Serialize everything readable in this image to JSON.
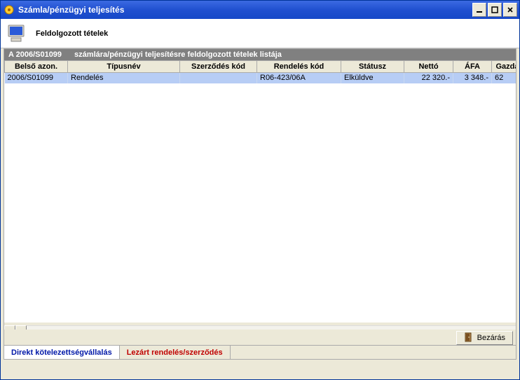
{
  "window": {
    "title": "Számla/pénzügyi teljesítés"
  },
  "header": {
    "title": "Feldolgozott tételek"
  },
  "listing": {
    "prefix": "A 2006/S01099",
    "suffix": "számlára/pénzügyi teljesítésre feldolgozott tételek listája"
  },
  "columns": {
    "belso_azon": "Belső azon.",
    "tipusnev": "Típusnév",
    "szerzodes_kod": "Szerződés kód",
    "rendeles_kod": "Rendelés kód",
    "statusz": "Státusz",
    "netto": "Nettó",
    "afa": "ÁFA",
    "gazda": "Gazdá"
  },
  "rows": [
    {
      "belso_azon": "2006/S01099",
      "tipusnev": "Rendelés",
      "szerzodes_kod": "",
      "rendeles_kod": "R06-423/06A",
      "statusz": "Elküldve",
      "netto": "22 320.-",
      "afa": "3 348.-",
      "gazda": "62"
    }
  ],
  "buttons": {
    "close": "Bezárás"
  },
  "tabs": {
    "direkt": "Direkt kötelezettségvállalás",
    "lezart": "Lezárt rendelés/szerződés"
  }
}
